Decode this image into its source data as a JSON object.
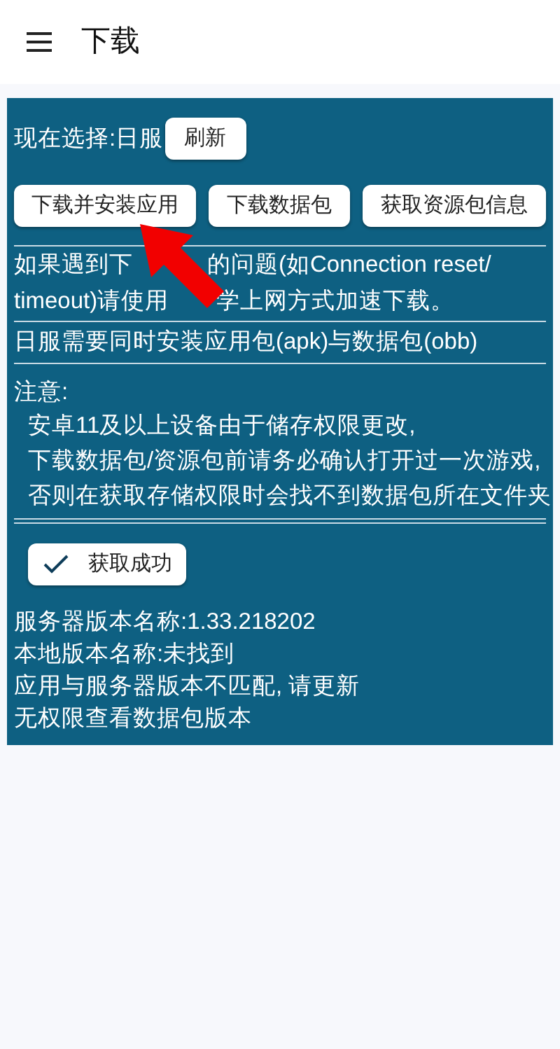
{
  "app_bar": {
    "title": "下载"
  },
  "selection": {
    "label": "现在选择:日服",
    "refresh_button": "刷新"
  },
  "actions": [
    "下载并安装应用",
    "下载数据包",
    "获取资源包信息"
  ],
  "tip_lines": [
    [
      "如果遇到下",
      "的问题(如Connection reset/"
    ],
    [
      "timeout)请使用",
      "学上网方式加速下载。"
    ]
  ],
  "requirement": "日服需要同时安装应用包(apk)与数据包(obb)",
  "notice": {
    "heading": "注意:",
    "lines": [
      "安卓11及以上设备由于储存权限更改,",
      "下载数据包/资源包前请务必确认打开过一次游戏,",
      "否则在获取存储权限时会找不到数据包所在文件夹"
    ]
  },
  "status_button": {
    "label": "获取成功",
    "checked": true
  },
  "info_lines": [
    "服务器版本名称:1.33.218202",
    "本地版本名称:未找到",
    "应用与服务器版本不匹配, 请更新",
    "无权限查看数据包版本"
  ]
}
